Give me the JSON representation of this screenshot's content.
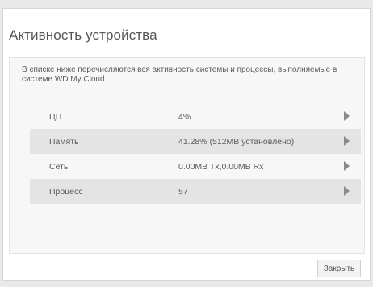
{
  "dialog": {
    "title": "Активность устройства",
    "description": "В списке ниже перечисляются вся активность системы и процессы, выполняемые в системе WD My Cloud.",
    "close_label": "Закрыть"
  },
  "activity": {
    "rows": [
      {
        "label": "ЦП",
        "value": "4%"
      },
      {
        "label": "Память",
        "value": "41.28% (512MB установлено)"
      },
      {
        "label": "Сеть",
        "value": "0.00MB Tx,0.00MB Rx"
      },
      {
        "label": "Процесс",
        "value": "57"
      }
    ]
  },
  "colors": {
    "page_background": "#e9e9e9",
    "dialog_background": "#ffffff",
    "panel_background": "#f7f7f7",
    "shaded_row": "#e4e4e4",
    "arrow": "#8a8a8a"
  },
  "icons": {
    "row_arrow": "chevron-right-icon"
  }
}
